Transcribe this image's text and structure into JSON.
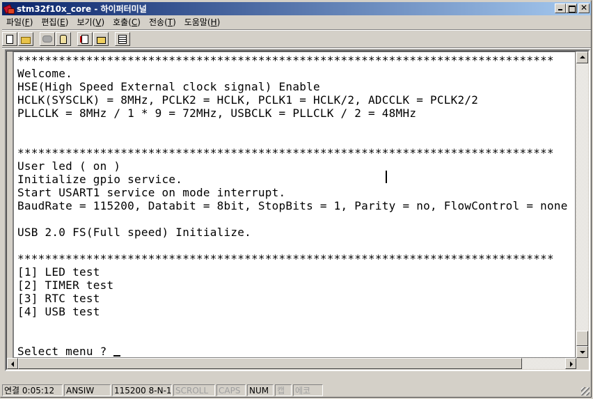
{
  "window": {
    "title": "stm32f10x_core - 하이퍼터미널",
    "caption_buttons": [
      "minimize",
      "maximize",
      "close"
    ]
  },
  "menu": [
    {
      "label": "파일",
      "key": "F"
    },
    {
      "label": "편집",
      "key": "E"
    },
    {
      "label": "보기",
      "key": "V"
    },
    {
      "label": "호출",
      "key": "C"
    },
    {
      "label": "전송",
      "key": "T"
    },
    {
      "label": "도움말",
      "key": "H"
    }
  ],
  "toolbar": [
    {
      "name": "new-icon"
    },
    {
      "name": "open-icon"
    },
    {
      "name": "connect-icon",
      "disabled": true
    },
    {
      "name": "disconnect-icon"
    },
    {
      "name": "send-icon"
    },
    {
      "name": "receive-icon"
    },
    {
      "name": "properties-icon"
    }
  ],
  "terminal": {
    "lines": [
      "******************************************************************************",
      "Welcome.",
      "HSE(High Speed External clock signal) Enable",
      "HCLK(SYSCLK) = 8MHz, PCLK2 = HCLK, PCLK1 = HCLK/2, ADCCLK = PCLK2/2",
      "PLLCLK = 8MHz / 1 * 9 = 72MHz, USBCLK = PLLCLK / 2 = 48MHz",
      "",
      "",
      "******************************************************************************",
      "User led ( on )",
      "Initialize gpio service.",
      "Start USART1 service on mode interrupt.",
      "BaudRate = 115200, Databit = 8bit, StopBits = 1, Parity = no, FlowControl = none",
      "",
      "USB 2.0 FS(Full speed) Initialize.",
      "",
      "******************************************************************************",
      "[1] LED test",
      "[2] TIMER test",
      "[3] RTC test",
      "[4] USB test",
      "",
      "",
      "Select menu ? "
    ]
  },
  "statusbar": {
    "connection": "연결 0:05:12",
    "emulation": "ANSIW",
    "port_settings": "115200 8-N-1",
    "scroll": "SCROLL",
    "caps": "CAPS",
    "num": "NUM",
    "capture": "캡",
    "echo": "에코"
  }
}
